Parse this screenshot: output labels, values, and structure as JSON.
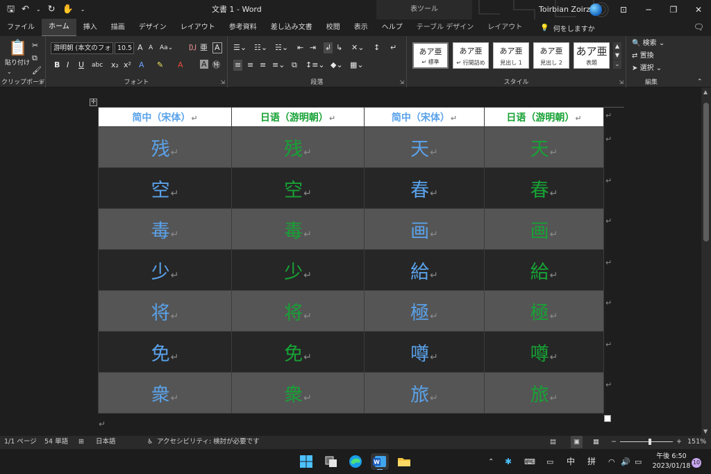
{
  "titlebar": {
    "doc_title": "文書 1  -  Word",
    "context_tool": "表ツール",
    "user_name": "Toirbian Zoirz",
    "qa_icons": [
      "save-icon",
      "undo-icon",
      "redo-icon",
      "touch-mode-icon",
      "customize-icon"
    ]
  },
  "tabs": {
    "items": [
      "ファイル",
      "ホーム",
      "挿入",
      "描画",
      "デザイン",
      "レイアウト",
      "参考資料",
      "差し込み文書",
      "校閲",
      "表示",
      "ヘルプ"
    ],
    "active": "ホーム",
    "context_items": [
      "テーブル デザイン",
      "レイアウト"
    ],
    "tell_me": "何をしますか"
  },
  "ribbon": {
    "clipboard": {
      "label": "クリップボード",
      "paste": "貼り付け"
    },
    "font": {
      "label": "フォント",
      "font_name": "游明朝 (本文のフォ",
      "font_size": "10.5"
    },
    "paragraph": {
      "label": "段落"
    },
    "styles": {
      "label": "スタイル",
      "cards": [
        {
          "sample": "あア亜",
          "name": "↵ 標準"
        },
        {
          "sample": "あア亜",
          "name": "↵ 行間詰め"
        },
        {
          "sample": "あア亜",
          "name": "見出し 1"
        },
        {
          "sample": "あア亜",
          "name": "見出し 2"
        },
        {
          "sample": "あア亜",
          "name": "表題"
        }
      ]
    },
    "editing": {
      "label": "編集",
      "find": "検索",
      "replace": "置換",
      "select": "選択"
    }
  },
  "table": {
    "headers": [
      "简中（宋体）",
      "日语（游明朝）",
      "简中（宋体）",
      "日语（游明朝）"
    ],
    "rows": [
      [
        "残",
        "残",
        "天",
        "天"
      ],
      [
        "空",
        "空",
        "春",
        "春"
      ],
      [
        "毒",
        "毒",
        "画",
        "画"
      ],
      [
        "少",
        "少",
        "給",
        "給"
      ],
      [
        "将",
        "将",
        "極",
        "極"
      ],
      [
        "免",
        "免",
        "噂",
        "噂"
      ],
      [
        "衆",
        "衆",
        "旅",
        "旅"
      ]
    ],
    "colors": {
      "blue": "#5aa2ea",
      "green": "#17a235"
    }
  },
  "statusbar": {
    "page": "1/1 ページ",
    "words": "54 単語",
    "language": "日本語",
    "accessibility": "アクセシビリティ: 検討が必要です",
    "zoom": "151%"
  },
  "taskbar": {
    "apps": [
      "windows-start-icon",
      "task-view-icon",
      "edge-icon",
      "word-icon",
      "file-explorer-icon"
    ],
    "ime_mode": "中",
    "ime_input": "拼",
    "clock_time": "午後 6:50",
    "clock_date": "2023/01/18",
    "notification_count": "10"
  }
}
